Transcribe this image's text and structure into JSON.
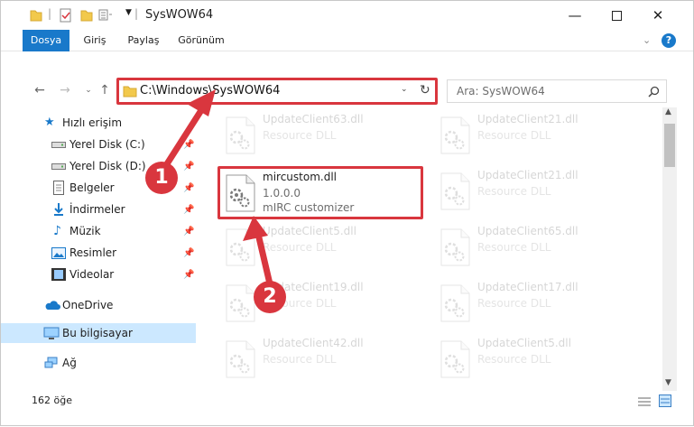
{
  "window": {
    "title": "SysWOW64"
  },
  "ribbon": {
    "tabs": [
      "Dosya",
      "Giriş",
      "Paylaş",
      "Görünüm"
    ]
  },
  "address": {
    "path": "C:\\Windows\\SysWOW64"
  },
  "search": {
    "placeholder": "Ara: SysWOW64"
  },
  "nav": {
    "quick_access": "Hızlı erişim",
    "items": [
      {
        "label": "Yerel Disk (C:)",
        "icon": "drive-icon"
      },
      {
        "label": "Yerel Disk (D:)",
        "icon": "drive-icon"
      },
      {
        "label": "Belgeler",
        "icon": "documents-icon"
      },
      {
        "label": "İndirmeler",
        "icon": "downloads-icon"
      },
      {
        "label": "Müzik",
        "icon": "music-icon"
      },
      {
        "label": "Resimler",
        "icon": "pictures-icon"
      },
      {
        "label": "Videolar",
        "icon": "videos-icon"
      }
    ],
    "onedrive": "OneDrive",
    "this_pc": "Bu bilgisayar",
    "network": "Ağ"
  },
  "files": {
    "highlighted": {
      "name": "mircustom.dll",
      "version": "1.0.0.0",
      "description": "mIRC customizer"
    },
    "left_column": [
      {
        "name": "UpdateClient63.dll",
        "type": "Resource DLL"
      },
      {
        "name": "UpdateClient5.dll",
        "type": "Resource DLL"
      },
      {
        "name": "UpdateClient19.dll",
        "type": "Resource DLL"
      },
      {
        "name": "UpdateClient42.dll",
        "type": "Resource DLL"
      }
    ],
    "right_column": [
      {
        "name": "UpdateClient21.dll",
        "type": "Resource DLL"
      },
      {
        "name": "UpdateClient21.dll",
        "type": "Resource DLL"
      },
      {
        "name": "UpdateClient65.dll",
        "type": "Resource DLL"
      },
      {
        "name": "UpdateClient17.dll",
        "type": "Resource DLL"
      },
      {
        "name": "UpdateClient5.dll",
        "type": "Resource DLL"
      }
    ]
  },
  "status": {
    "count": "162 öğe"
  },
  "annotations": {
    "step1": "1",
    "step2": "2",
    "color": "#d9363e"
  }
}
